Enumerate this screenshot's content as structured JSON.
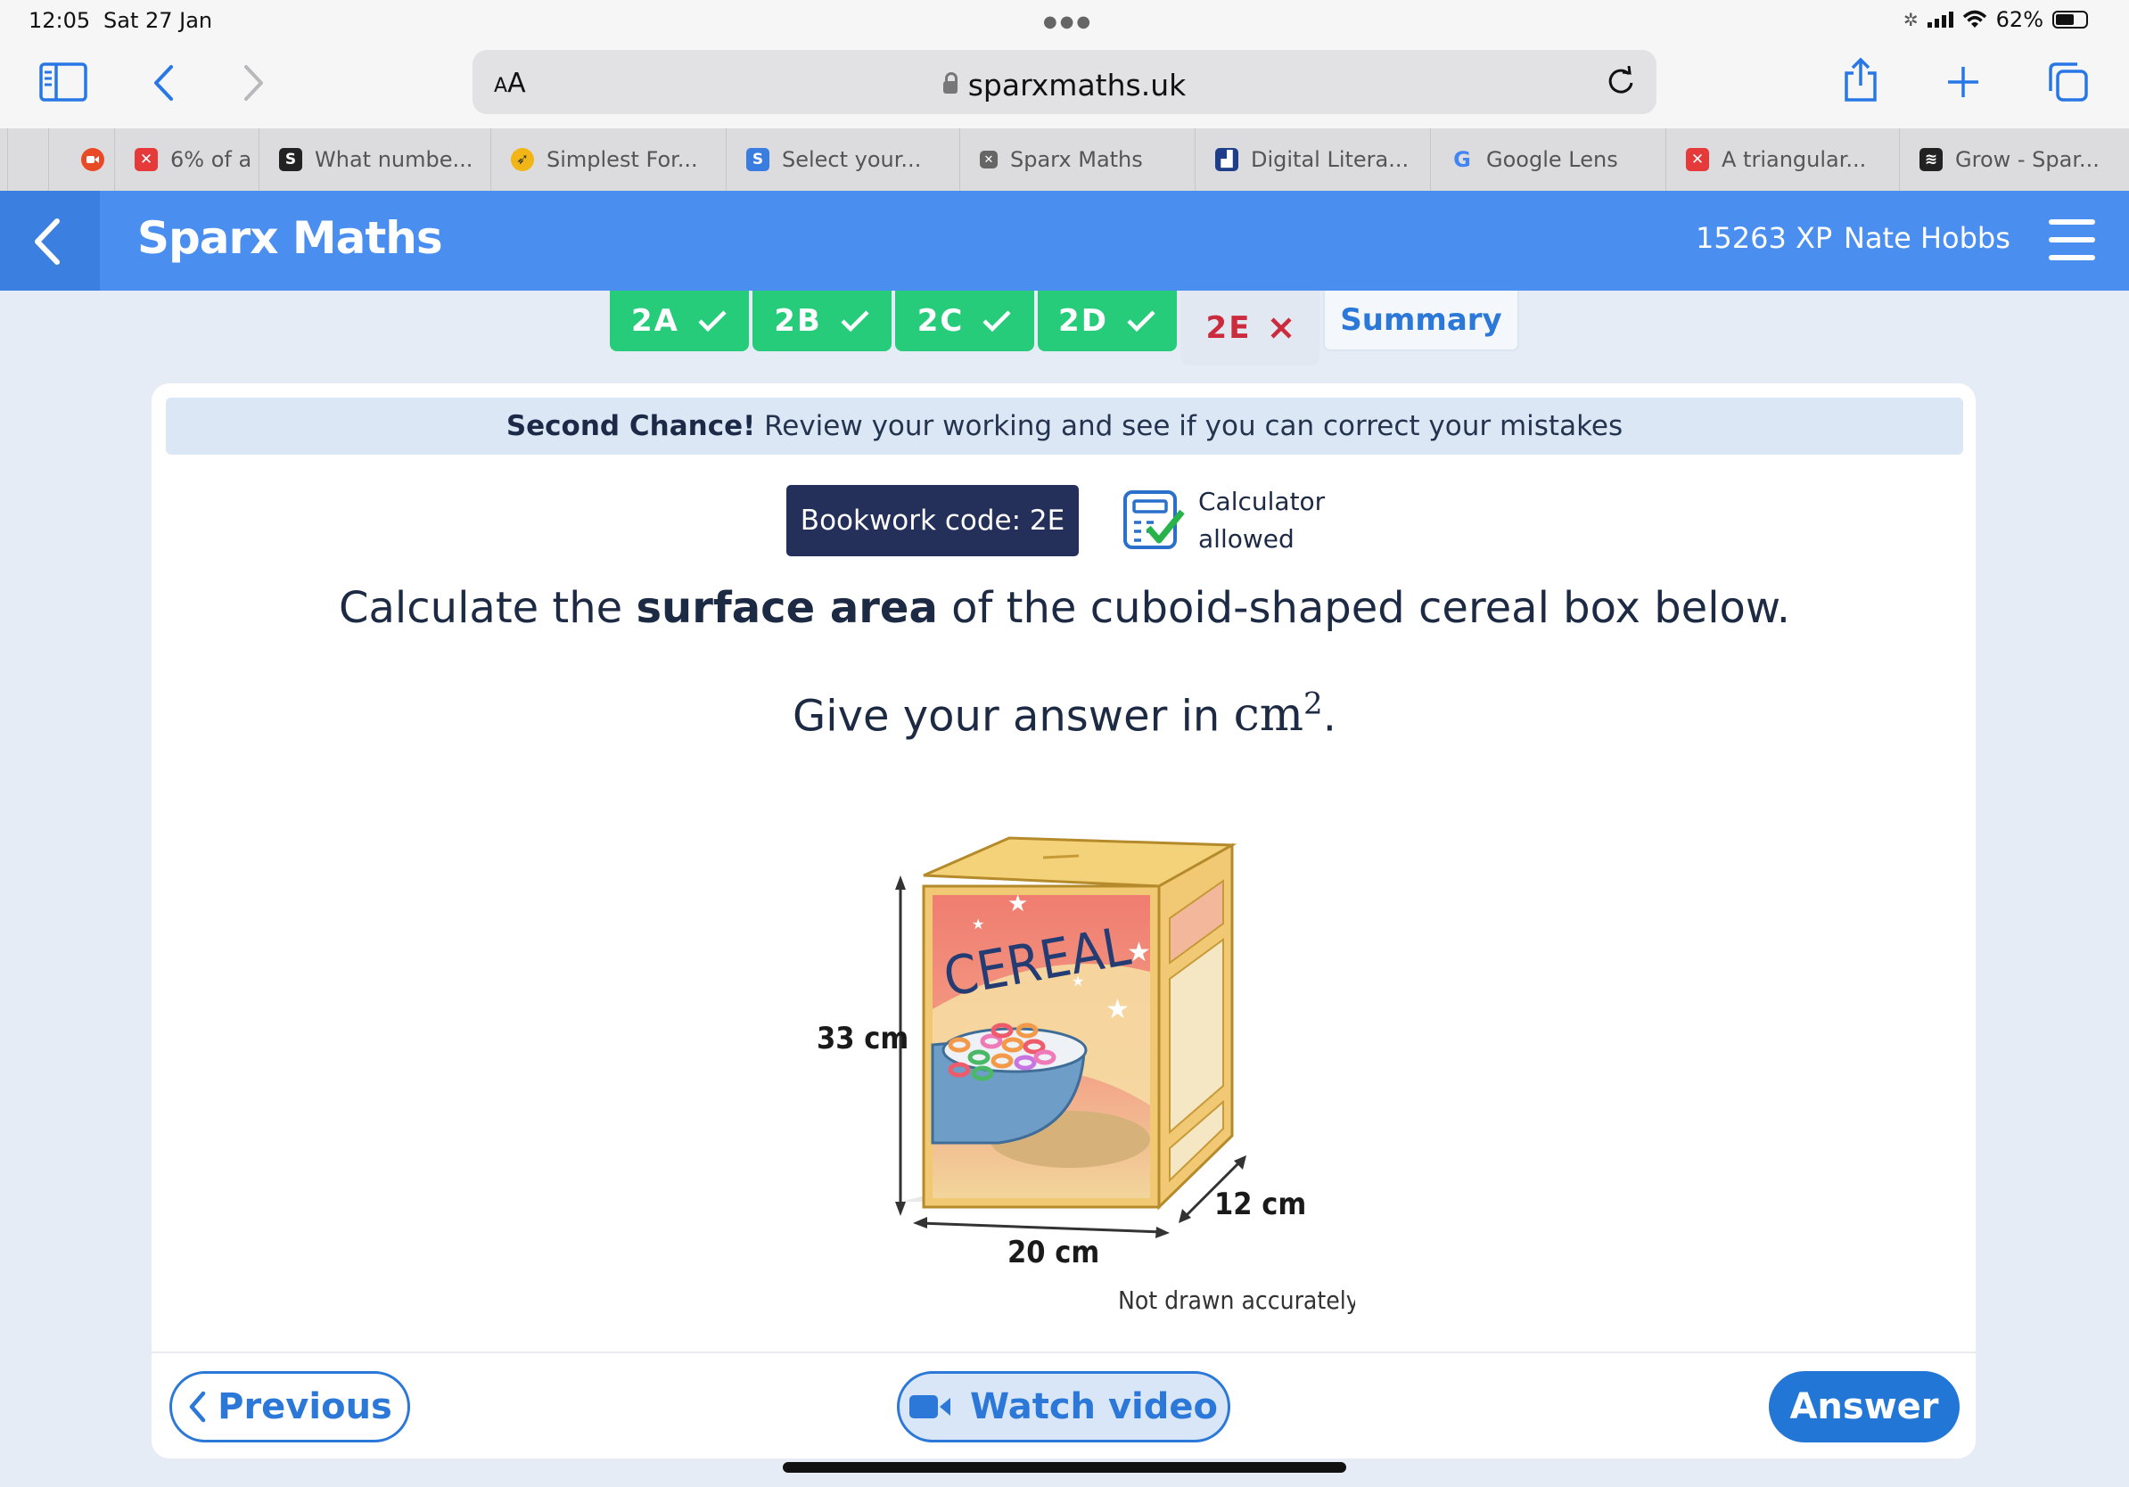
{
  "status_bar": {
    "time": "12:05",
    "date": "Sat 27 Jan",
    "battery": "62%",
    "battery_level": 0.62
  },
  "browser": {
    "aa_label": "A",
    "aa_label_big": "A",
    "url": "sparxmaths.uk",
    "tabs": [
      {
        "title": "6% of a",
        "favicon": "red-x-icon",
        "color": "#e5393a"
      },
      {
        "title": "What numbe...",
        "favicon": "S",
        "color": "#222222"
      },
      {
        "title": "Simplest For...",
        "favicon": "rocket-icon",
        "color": "#f2b516"
      },
      {
        "title": "Select your...",
        "favicon": "S",
        "color": "#3a7de0"
      },
      {
        "title": "Sparx Maths",
        "favicon": "close-icon",
        "color": "#666666",
        "active": true
      },
      {
        "title": "Digital Litera...",
        "favicon": "digital-icon",
        "color": "#1e3e8a"
      },
      {
        "title": "Google Lens",
        "favicon": "google-icon",
        "color": "#4285f4"
      },
      {
        "title": "A triangular...",
        "favicon": "red-x-icon",
        "color": "#e5393a"
      },
      {
        "title": "Grow - Spar...",
        "favicon": "stack-icon",
        "color": "#222222"
      }
    ]
  },
  "app": {
    "title": "Sparx Maths",
    "xp": "15263 XP",
    "user": "Nate Hobbs"
  },
  "task_tabs": [
    {
      "label": "2A",
      "status": "done"
    },
    {
      "label": "2B",
      "status": "done"
    },
    {
      "label": "2C",
      "status": "done"
    },
    {
      "label": "2D",
      "status": "done"
    },
    {
      "label": "2E",
      "status": "wrong"
    },
    {
      "label": "Summary",
      "status": "summary"
    }
  ],
  "banner": {
    "bold": "Second Chance!",
    "text": " Review your working and see if you can correct your mistakes"
  },
  "bookwork_code": "Bookwork code: 2E",
  "calculator": {
    "line1": "Calculator",
    "line2": "allowed"
  },
  "question": {
    "line1_pre": "Calculate the ",
    "line1_bold": "surface area",
    "line1_post": " of the cuboid-shaped cereal box below.",
    "line2_pre": "Give your answer in ",
    "unit": "cm",
    "unit_power": "2",
    "line2_post": "."
  },
  "figure": {
    "box_label": "CEREAL",
    "height": "33 cm",
    "width": "20 cm",
    "depth": "12 cm",
    "note": "Not drawn accurately"
  },
  "buttons": {
    "previous": "Previous",
    "watch_video": "Watch video",
    "answer": "Answer"
  },
  "colors": {
    "header_blue": "#4a8ff0",
    "done_green": "#27cc7a",
    "wrong_red": "#cc2a3d",
    "primary_blue": "#2176d6"
  }
}
